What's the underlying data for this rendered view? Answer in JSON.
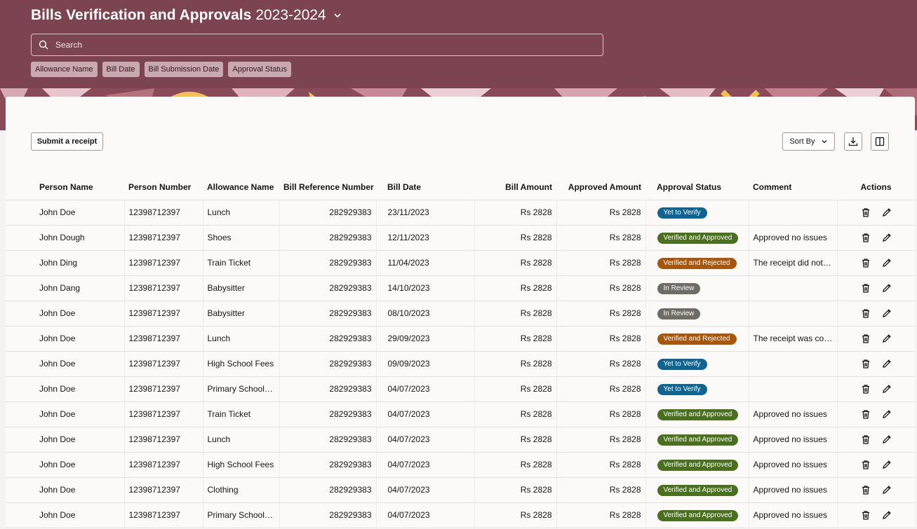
{
  "header": {
    "title": "Bills Verification and Approvals",
    "year": "2023-2024",
    "search_placeholder": "Search",
    "filters": [
      "Allowance Name",
      "Bill Date",
      "Bill Submission Date",
      "Approval Status"
    ]
  },
  "toolbar": {
    "submit_label": "Submit a receipt",
    "sort_label": "Sort By",
    "icons": [
      "download-icon",
      "columns-icon"
    ]
  },
  "colors": {
    "header_bg": "#7b4450",
    "status": {
      "Yet to Verify": "#0f6492",
      "Verified and Approved": "#4a6f1f",
      "Verified and Rejected": "#a7560d",
      "In Review": "#6f6b66"
    }
  },
  "table": {
    "columns": [
      "Person Name",
      "Person Number",
      "Allowance Name",
      "Bill Reference Number",
      "Bill Date",
      "Bill Amount",
      "Approved Amount",
      "Approval Status",
      "Comment",
      "Actions"
    ],
    "rows": [
      {
        "name": "John Doe",
        "number": "12398712397",
        "allowance": "Lunch",
        "ref": "282929383",
        "date": "23/11/2023",
        "amount": "Rs 2828",
        "approved": "Rs 2828",
        "status": "Yet to Verify",
        "comment": ""
      },
      {
        "name": "John Dough",
        "number": "12398712397",
        "allowance": "Shoes",
        "ref": "282929383",
        "date": "12/11/2023",
        "amount": "Rs 2828",
        "approved": "Rs 2828",
        "status": "Verified and Approved",
        "comment": "Approved no issues"
      },
      {
        "name": "John Ding",
        "number": "12398712397",
        "allowance": "Train Ticket",
        "ref": "282929383",
        "date": "11/04/2023",
        "amount": "Rs 2828",
        "approved": "Rs 2828",
        "status": "Verified and Rejected",
        "comment": "The receipt did not…"
      },
      {
        "name": "John Dang",
        "number": "12398712397",
        "allowance": "Babysitter",
        "ref": "282929383",
        "date": "14/10/2023",
        "amount": "Rs 2828",
        "approved": "Rs 2828",
        "status": "In Review",
        "comment": ""
      },
      {
        "name": "John Doe",
        "number": "12398712397",
        "allowance": "Babysitter",
        "ref": "282929383",
        "date": "08/10/2023",
        "amount": "Rs 2828",
        "approved": "Rs 2828",
        "status": "In Review",
        "comment": ""
      },
      {
        "name": "John Doe",
        "number": "12398712397",
        "allowance": "Lunch",
        "ref": "282929383",
        "date": "29/09/2023",
        "amount": "Rs 2828",
        "approved": "Rs 2828",
        "status": "Verified and Rejected",
        "comment": "The receipt was cor…"
      },
      {
        "name": "John Doe",
        "number": "12398712397",
        "allowance": "High School Fees",
        "ref": "282929383",
        "date": "09/09/2023",
        "amount": "Rs 2828",
        "approved": "Rs 2828",
        "status": "Yet to Verify",
        "comment": ""
      },
      {
        "name": "John Doe",
        "number": "12398712397",
        "allowance": "Primary School…",
        "ref": "282929383",
        "date": "04/07/2023",
        "amount": "Rs 2828",
        "approved": "Rs 2828",
        "status": "Yet to Verify",
        "comment": ""
      },
      {
        "name": "John Doe",
        "number": "12398712397",
        "allowance": "Train Ticket",
        "ref": "282929383",
        "date": "04/07/2023",
        "amount": "Rs 2828",
        "approved": "Rs 2828",
        "status": "Verified and Approved",
        "comment": "Approved no issues"
      },
      {
        "name": "John Doe",
        "number": "12398712397",
        "allowance": "Lunch",
        "ref": "282929383",
        "date": "04/07/2023",
        "amount": "Rs 2828",
        "approved": "Rs 2828",
        "status": "Verified and Approved",
        "comment": "Approved no issues"
      },
      {
        "name": "John Doe",
        "number": "12398712397",
        "allowance": "High School Fees",
        "ref": "282929383",
        "date": "04/07/2023",
        "amount": "Rs 2828",
        "approved": "Rs 2828",
        "status": "Verified and Approved",
        "comment": "Approved no issues"
      },
      {
        "name": "John Doe",
        "number": "12398712397",
        "allowance": "Clothing",
        "ref": "282929383",
        "date": "04/07/2023",
        "amount": "Rs 2828",
        "approved": "Rs 2828",
        "status": "Verified and Approved",
        "comment": "Approved no issues"
      },
      {
        "name": "John Doe",
        "number": "12398712397",
        "allowance": "Primary School…",
        "ref": "282929383",
        "date": "04/07/2023",
        "amount": "Rs 2828",
        "approved": "Rs 2828",
        "status": "Verified and Approved",
        "comment": "Approved no issues"
      }
    ]
  }
}
